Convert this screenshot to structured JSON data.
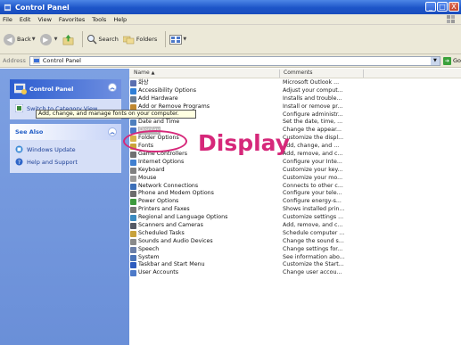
{
  "window": {
    "title": "Control Panel",
    "min": "_",
    "max": "□",
    "close": "X"
  },
  "menu": [
    "File",
    "Edit",
    "View",
    "Favorites",
    "Tools",
    "Help"
  ],
  "toolbar": {
    "back": "Back",
    "search": "Search",
    "folders": "Folders"
  },
  "address": {
    "label": "Address",
    "value": "Control Panel",
    "go": "Go"
  },
  "sidebar": {
    "control_panel_title": "Control Panel",
    "switch_view": "Switch to Category View",
    "see_also_title": "See Also",
    "see_also_items": [
      "Windows Update",
      "Help and Support"
    ]
  },
  "columns": {
    "name": "Name",
    "comments": "Comments"
  },
  "items": [
    {
      "name": "화상",
      "comment": "Microsoft Outlook ...",
      "color": "#5b6fb0"
    },
    {
      "name": "Accessibility Options",
      "comment": "Adjust your comput...",
      "color": "#2f7fd6"
    },
    {
      "name": "Add Hardware",
      "comment": "Installs and trouble...",
      "color": "#6a7d93"
    },
    {
      "name": "Add or Remove Programs",
      "comment": "Install or remove pr...",
      "color": "#c0882f"
    },
    {
      "name": "Administrative Tools",
      "comment": "Configure administr...",
      "color": "#7c8a9a"
    },
    {
      "name": "Date and Time",
      "comment": "Set the date, time, ...",
      "color": "#4e7fbe"
    },
    {
      "name": "Display",
      "comment": "Change the appear...",
      "color": "#4c78c8"
    },
    {
      "name": "Folder Options",
      "comment": "Customize the displ...",
      "color": "#d8b34a"
    },
    {
      "name": "Fonts",
      "comment": "Add, change, and ...",
      "color": "#caa43a"
    },
    {
      "name": "Game Controllers",
      "comment": "Add, remove, and c...",
      "color": "#707070"
    },
    {
      "name": "Internet Options",
      "comment": "Configure your Inte...",
      "color": "#3f7fd0"
    },
    {
      "name": "Keyboard",
      "comment": "Customize your key...",
      "color": "#808080"
    },
    {
      "name": "Mouse",
      "comment": "Customize your mo...",
      "color": "#9a9a9a"
    },
    {
      "name": "Network Connections",
      "comment": "Connects to other c...",
      "color": "#3c6fb8"
    },
    {
      "name": "Phone and Modem Options",
      "comment": "Configure your tele...",
      "color": "#6d6d6d"
    },
    {
      "name": "Power Options",
      "comment": "Configure energy-s...",
      "color": "#3d9a3d"
    },
    {
      "name": "Printers and Faxes",
      "comment": "Shows installed prin...",
      "color": "#777777"
    },
    {
      "name": "Regional and Language Options",
      "comment": "Customize settings ...",
      "color": "#3a8ac0"
    },
    {
      "name": "Scanners and Cameras",
      "comment": "Add, remove, and c...",
      "color": "#555a66"
    },
    {
      "name": "Scheduled Tasks",
      "comment": "Schedule computer ...",
      "color": "#c8a23c"
    },
    {
      "name": "Sounds and Audio Devices",
      "comment": "Change the sound s...",
      "color": "#8a8a8a"
    },
    {
      "name": "Speech",
      "comment": "Change settings for...",
      "color": "#6b7fa8"
    },
    {
      "name": "System",
      "comment": "See information abo...",
      "color": "#4b74b8"
    },
    {
      "name": "Taskbar and Start Menu",
      "comment": "Customize the Start...",
      "color": "#2e5cbf"
    },
    {
      "name": "User Accounts",
      "comment": "Change user accou...",
      "color": "#4d7ac9"
    }
  ],
  "tooltip": "Add, change, and manage fonts on your computer.",
  "annotation": "Display"
}
